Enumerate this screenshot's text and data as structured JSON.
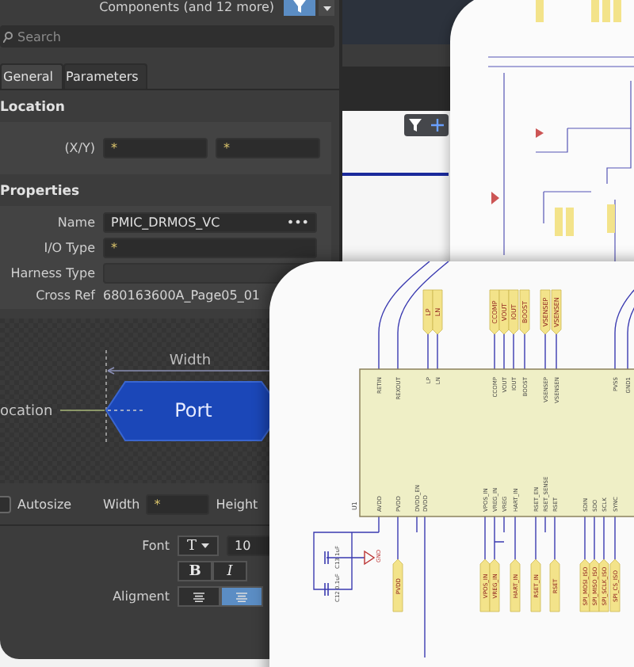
{
  "panel": {
    "header": {
      "title": "Components (and 12 more)"
    },
    "search": {
      "placeholder": "Search"
    },
    "tabs": [
      {
        "label": "General",
        "selected": true
      },
      {
        "label": "Parameters",
        "selected": false
      }
    ],
    "location": {
      "heading": "Location",
      "label": "(X/Y)",
      "x": "*",
      "y": "*"
    },
    "properties": {
      "heading": "Properties",
      "rows": [
        {
          "kind": "field",
          "label": "Name",
          "value": "PMIC_DRMOS_VC",
          "more": "•••"
        },
        {
          "kind": "field",
          "label": "I/O Type",
          "value": "*"
        },
        {
          "kind": "field",
          "label": "Harness Type"
        },
        {
          "kind": "text",
          "label": "Cross Ref",
          "value": "680163600A_Page05_01"
        }
      ]
    },
    "diagram": {
      "width_label": "Width",
      "location_label": "ocation",
      "port_label": "Port"
    },
    "size": {
      "autosize": {
        "label": "Autosize",
        "checked": false
      },
      "width": {
        "label": "Width",
        "value": "*"
      },
      "height": {
        "label": "Height"
      }
    },
    "font": {
      "label": "Font",
      "type_glyph": "T",
      "size": "10",
      "styles": [
        "B",
        "I"
      ],
      "alignment_label": "Aligment",
      "alignment": [
        {
          "selected": false
        },
        {
          "selected": true
        }
      ]
    }
  },
  "schematic": {
    "ref": "U1",
    "top_pins": [
      {
        "name": "RETIN"
      },
      {
        "name": "REXOUT"
      },
      {
        "name": "LP",
        "net": "LP"
      },
      {
        "name": "LN",
        "net": "LN"
      },
      {
        "name": "CCOMP",
        "net": "CCOMP"
      },
      {
        "name": "VOUT",
        "net": "VOUT"
      },
      {
        "name": "IOUT",
        "net": "IOUT"
      },
      {
        "name": "BOOST",
        "net": "BOOST"
      },
      {
        "name": "VSENSEP",
        "net": "VSENSEP"
      },
      {
        "name": "VSENSEN",
        "net": "VSENSEN"
      },
      {
        "name": "PVSS"
      },
      {
        "name": "GND1"
      }
    ],
    "bottom_pins": [
      {
        "name": "AVDD"
      },
      {
        "name": "PVDD",
        "net": "PVDD"
      },
      {
        "name": "DVDD_EN"
      },
      {
        "name": "DVDD"
      },
      {
        "name": "VPOS_IN",
        "net": "VPOS_IN"
      },
      {
        "name": "VREG_IN",
        "net": "VREG_IN"
      },
      {
        "name": "VREG"
      },
      {
        "name": "HART_IN",
        "net": "HART_IN"
      },
      {
        "name": "RSET_EN",
        "net": "RSET_IN"
      },
      {
        "name": "RSET_SENSE"
      },
      {
        "name": "RSET",
        "net": "RSET"
      },
      {
        "name": "SDIN",
        "net": "SPI_MOSI_ISO"
      },
      {
        "name": "SDO",
        "net": "SPI_MISO_ISO"
      },
      {
        "name": "SCLK",
        "net": "SPI_SCLK_ISO"
      },
      {
        "name": "SYNC",
        "net": "SPI_CS_ISO"
      }
    ],
    "parts": [
      {
        "ref": "C13",
        "value": "1uF"
      },
      {
        "ref": "C12",
        "value": "0.1uF"
      }
    ],
    "ground": "GND"
  }
}
